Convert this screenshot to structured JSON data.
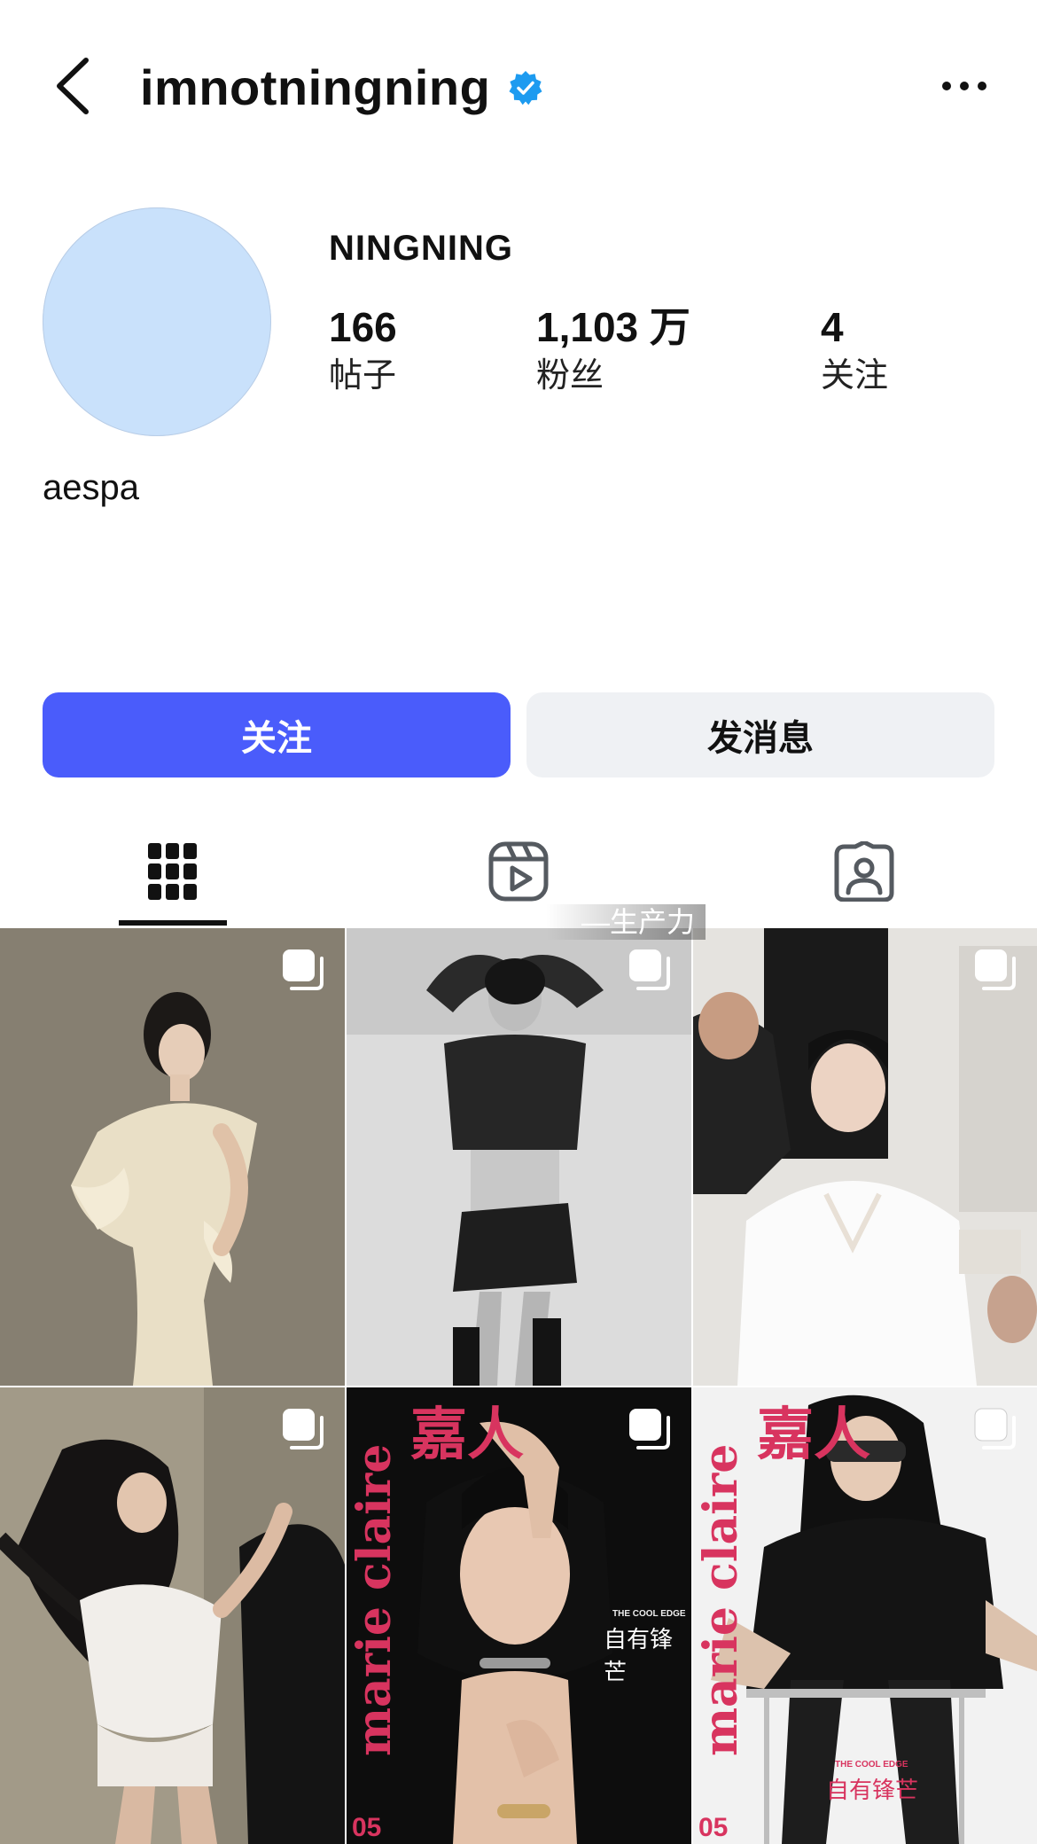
{
  "header": {
    "username": "imnotningning",
    "back_icon": "chevron-left-icon",
    "verified_icon": "verified-badge-icon",
    "more_icon": "ellipsis-icon",
    "accent_color": "#1d9bf0"
  },
  "profile": {
    "display_name": "NINGNING",
    "bio": "aespa",
    "stats": [
      {
        "value": "166",
        "label": "帖子"
      },
      {
        "value": "1,103 万",
        "label": "粉丝"
      },
      {
        "value": "4",
        "label": "关注"
      }
    ]
  },
  "actions": {
    "follow_label": "关注",
    "message_label": "发消息",
    "follow_color": "#4a5cfb"
  },
  "tabs": [
    {
      "icon": "grid-icon",
      "active": true
    },
    {
      "icon": "reels-icon",
      "active": false
    },
    {
      "icon": "tagged-icon",
      "active": false
    }
  ],
  "watermark": "—生产力",
  "posts": [
    {
      "type": "carousel",
      "icon": "carousel-icon"
    },
    {
      "type": "carousel",
      "icon": "carousel-icon"
    },
    {
      "type": "carousel",
      "icon": "carousel-icon"
    },
    {
      "type": "carousel",
      "icon": "carousel-icon"
    },
    {
      "type": "carousel",
      "icon": "carousel-icon",
      "cover_logo": "marie claire",
      "cover_title": "嘉人",
      "cover_subtitle_en": "THE COOL EDGE",
      "cover_subtitle_cn": "自有锋芒",
      "issue": "05"
    },
    {
      "type": "carousel",
      "icon": "carousel-icon",
      "cover_logo": "marie claire",
      "cover_title": "嘉人",
      "cover_subtitle_en": "THE COOL EDGE",
      "cover_subtitle_cn": "自有锋芒",
      "issue": "05"
    }
  ]
}
